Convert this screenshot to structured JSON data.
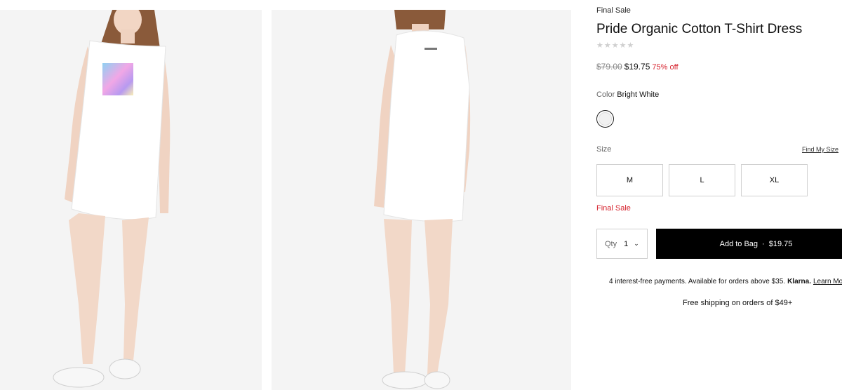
{
  "gallery": {
    "images": [
      {
        "alt": "Front view of white t-shirt dress with colorful graphic"
      },
      {
        "alt": "Back view of white t-shirt dress"
      }
    ]
  },
  "product": {
    "badge": "Final Sale",
    "title": "Pride Organic Cotton T-Shirt Dress",
    "stars": "★★★★★",
    "rating": 0,
    "price_original": "$79.00",
    "price_sale": "$19.75",
    "discount": "75% off"
  },
  "color": {
    "label": "Color",
    "value": "Bright White",
    "swatch_hex": "#f1f1f1"
  },
  "size": {
    "label": "Size",
    "find_link": "Find My Size",
    "options": [
      "M",
      "L",
      "XL"
    ]
  },
  "final_sale_notice": "Final Sale",
  "purchase": {
    "qty_label": "Qty",
    "qty_value": "1",
    "qty_chevron": "⌄",
    "add_label": "Add to Bag",
    "separator": "·",
    "add_price": "$19.75"
  },
  "klarna": {
    "text": "4 interest-free payments. Available for orders above $35.",
    "brand": "Klarna.",
    "learn": "Learn More"
  },
  "shipping": "Free shipping on orders of $49+",
  "colors": {
    "sale_red": "#d6222d",
    "button_black": "#000000"
  }
}
